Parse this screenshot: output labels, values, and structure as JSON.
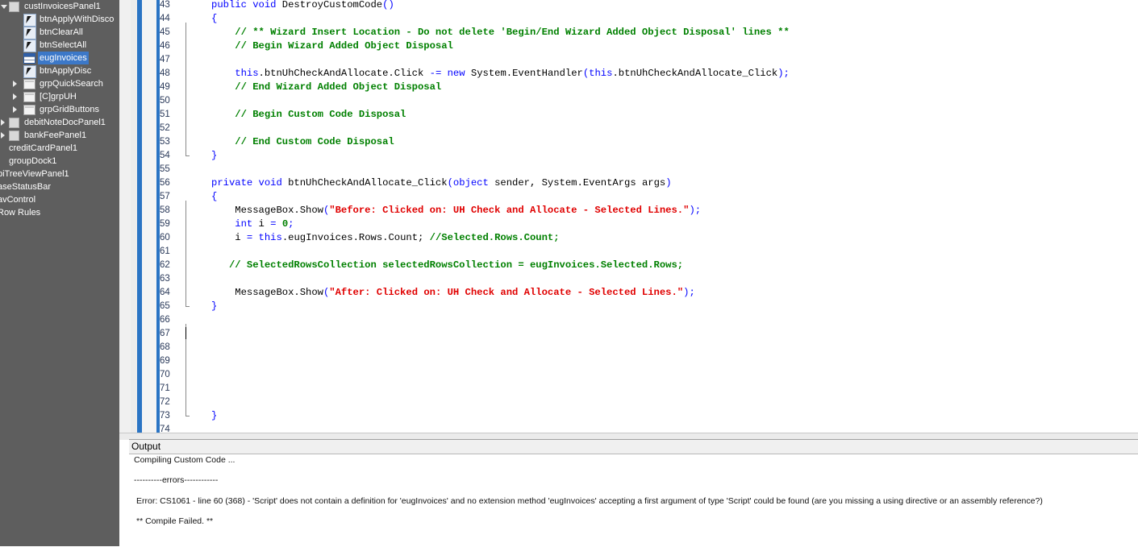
{
  "tree": {
    "items": [
      {
        "label": "custInvoicesPanel1",
        "expander": "down",
        "icon": "panel-icon",
        "indent": 0
      },
      {
        "label": "btnApplyWithDisco",
        "expander": "",
        "icon": "button-icon",
        "indent": 2
      },
      {
        "label": "btnClearAll",
        "expander": "",
        "icon": "button-icon",
        "indent": 2
      },
      {
        "label": "btnSelectAll",
        "expander": "",
        "icon": "button-icon",
        "indent": 2
      },
      {
        "label": "eugInvoices",
        "expander": "",
        "icon": "grid-icon",
        "indent": 2,
        "selected": true
      },
      {
        "label": "btnApplyDisc",
        "expander": "",
        "icon": "button-icon",
        "indent": 2
      },
      {
        "label": "grpQuickSearch",
        "expander": "right",
        "icon": "groupbox-icon",
        "indent": 1
      },
      {
        "label": "[C]grpUH",
        "expander": "right",
        "icon": "groupbox-icon",
        "indent": 1
      },
      {
        "label": "grpGridButtons",
        "expander": "right",
        "icon": "groupbox-icon",
        "indent": 1
      },
      {
        "label": "debitNoteDocPanel1",
        "expander": "right",
        "icon": "panel-icon",
        "indent": 0
      },
      {
        "label": "bankFeePanel1",
        "expander": "right",
        "icon": "panel-icon",
        "indent": 0
      },
      {
        "label": "creditCardPanel1",
        "expander": "",
        "icon": "",
        "indent": -1
      },
      {
        "label": "groupDock1",
        "expander": "",
        "icon": "",
        "indent": -1
      },
      {
        "label": "piTreeViewPanel1",
        "expander": "",
        "icon": "",
        "indent": -2
      },
      {
        "label": "aseStatusBar",
        "expander": "",
        "icon": "",
        "indent": -2
      },
      {
        "label": "avControl",
        "expander": "",
        "icon": "",
        "indent": -2
      },
      {
        "label": "Row Rules",
        "expander": "",
        "icon": "",
        "indent": -2
      }
    ]
  },
  "editor": {
    "lines": [
      {
        "n": "43",
        "tokens": [
          [
            "kw",
            "public "
          ],
          [
            "kw",
            "void "
          ],
          [
            "tx",
            "DestroyCustomCode"
          ],
          [
            "pn",
            "()"
          ]
        ]
      },
      {
        "n": "44",
        "tokens": [
          [
            "pn",
            "{"
          ]
        ]
      },
      {
        "n": "45",
        "tokens": [
          [
            "tx",
            "    "
          ],
          [
            "cm",
            "// ** Wizard Insert Location - Do not delete 'Begin/End Wizard Added Object Disposal' lines **"
          ]
        ]
      },
      {
        "n": "46",
        "tokens": [
          [
            "tx",
            "    "
          ],
          [
            "cm",
            "// Begin Wizard Added Object Disposal"
          ]
        ]
      },
      {
        "n": "47",
        "tokens": []
      },
      {
        "n": "48",
        "tokens": [
          [
            "tx",
            "    "
          ],
          [
            "kw",
            "this"
          ],
          [
            "tx",
            ".btnUhCheckAndAllocate.Click "
          ],
          [
            "pn",
            "-="
          ],
          [
            "tx",
            " "
          ],
          [
            "kw",
            "new "
          ],
          [
            "tx",
            "System.EventHandler"
          ],
          [
            "pn",
            "("
          ],
          [
            "kw",
            "this"
          ],
          [
            "tx",
            ".btnUhCheckAndAllocate_Click"
          ],
          [
            "pn",
            ");"
          ]
        ]
      },
      {
        "n": "49",
        "tokens": [
          [
            "tx",
            "    "
          ],
          [
            "cm",
            "// End Wizard Added Object Disposal"
          ]
        ]
      },
      {
        "n": "50",
        "tokens": []
      },
      {
        "n": "51",
        "tokens": [
          [
            "tx",
            "    "
          ],
          [
            "cm",
            "// Begin Custom Code Disposal"
          ]
        ]
      },
      {
        "n": "52",
        "tokens": []
      },
      {
        "n": "53",
        "tokens": [
          [
            "tx",
            "    "
          ],
          [
            "cm",
            "// End Custom Code Disposal"
          ]
        ]
      },
      {
        "n": "54",
        "tokens": [
          [
            "pn",
            "}"
          ]
        ]
      },
      {
        "n": "55",
        "tokens": []
      },
      {
        "n": "56",
        "tokens": [
          [
            "kw",
            "private "
          ],
          [
            "kw",
            "void "
          ],
          [
            "tx",
            "btnUhCheckAndAllocate_Click"
          ],
          [
            "pn",
            "("
          ],
          [
            "kw",
            "object "
          ],
          [
            "tx",
            "sender, System.EventArgs args"
          ],
          [
            "pn",
            ")"
          ]
        ]
      },
      {
        "n": "57",
        "tokens": [
          [
            "pn",
            "{"
          ]
        ]
      },
      {
        "n": "58",
        "tokens": [
          [
            "tx",
            "    MessageBox.Show"
          ],
          [
            "pn",
            "("
          ],
          [
            "st",
            "\"Before: Clicked on: UH Check and Allocate - Selected Lines.\""
          ],
          [
            "pn",
            ");"
          ]
        ]
      },
      {
        "n": "59",
        "tokens": [
          [
            "tx",
            "    "
          ],
          [
            "kw",
            "int "
          ],
          [
            "tx",
            "i "
          ],
          [
            "pn",
            "="
          ],
          [
            "tx",
            " "
          ],
          [
            "cm",
            "0"
          ],
          [
            "pn",
            ";"
          ]
        ]
      },
      {
        "n": "60",
        "tokens": [
          [
            "tx",
            "    i "
          ],
          [
            "pn",
            "="
          ],
          [
            "tx",
            " "
          ],
          [
            "kw",
            "this"
          ],
          [
            "tx",
            ".eugInvoices.Rows.Count; "
          ],
          [
            "cm",
            "//Selected.Rows.Count;"
          ]
        ]
      },
      {
        "n": "61",
        "tokens": []
      },
      {
        "n": "62",
        "tokens": [
          [
            "tx",
            "   "
          ],
          [
            "cm",
            "// SelectedRowsCollection selectedRowsCollection = eugInvoices.Selected.Rows;"
          ]
        ]
      },
      {
        "n": "63",
        "tokens": []
      },
      {
        "n": "64",
        "tokens": [
          [
            "tx",
            "    MessageBox.Show"
          ],
          [
            "pn",
            "("
          ],
          [
            "st",
            "\"After: Clicked on: UH Check and Allocate - Selected Lines.\""
          ],
          [
            "pn",
            ");"
          ]
        ]
      },
      {
        "n": "65",
        "tokens": [
          [
            "pn",
            "}"
          ]
        ]
      },
      {
        "n": "66",
        "tokens": []
      },
      {
        "n": "67",
        "tokens": []
      },
      {
        "n": "68",
        "tokens": []
      },
      {
        "n": "69",
        "tokens": []
      },
      {
        "n": "70",
        "tokens": []
      },
      {
        "n": "71",
        "tokens": []
      },
      {
        "n": "72",
        "tokens": []
      },
      {
        "n": "73",
        "tokens": [
          [
            "pn",
            "}"
          ]
        ]
      },
      {
        "n": "74",
        "tokens": []
      }
    ]
  },
  "output": {
    "title": "Output",
    "lines": [
      "Compiling Custom Code ...",
      "----------errors------------",
      "Error: CS1061 - line 60 (368) - 'Script' does not contain a definition for 'eugInvoices' and no extension method 'eugInvoices' accepting a first argument of type 'Script' could be found (are you missing a using directive or an assembly reference?)",
      "** Compile Failed. **"
    ]
  }
}
